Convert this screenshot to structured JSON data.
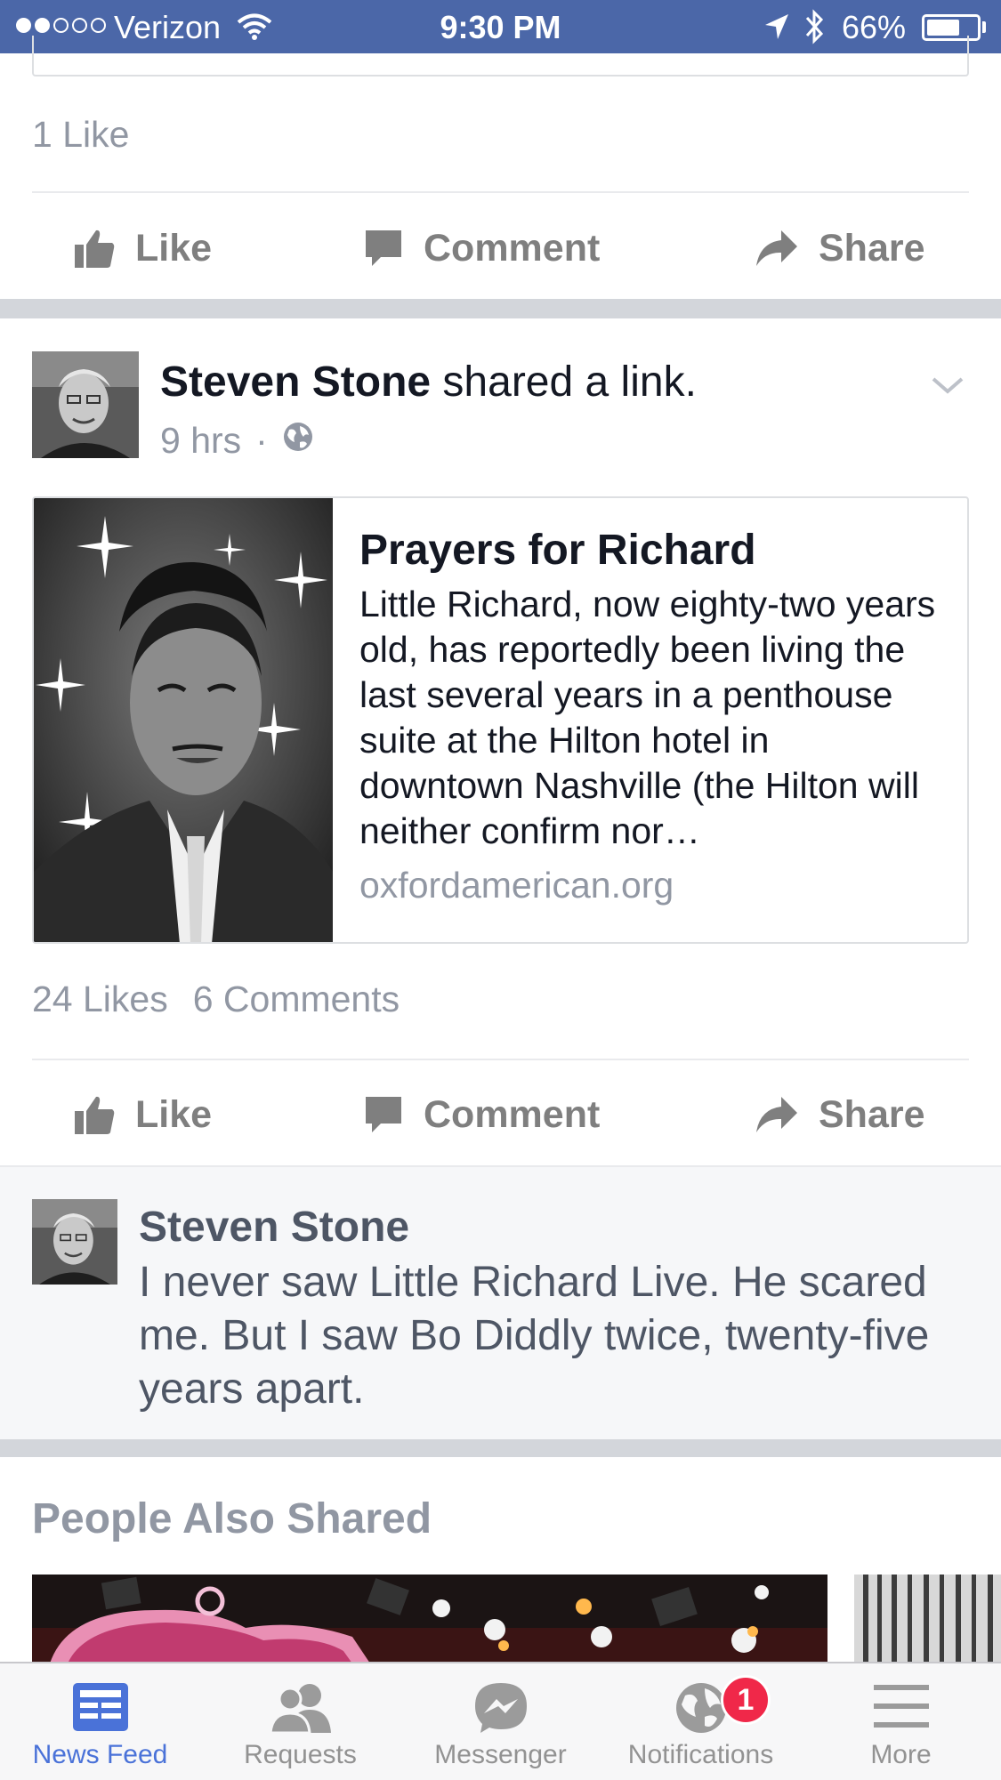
{
  "status_bar": {
    "carrier": "Verizon",
    "time": "9:30 PM",
    "battery_percent": "66%",
    "battery_level": 0.66,
    "signal_bars_filled": 2,
    "signal_bars_total": 5
  },
  "previous_post": {
    "likes_text": "1 Like"
  },
  "actions": {
    "like": "Like",
    "comment": "Comment",
    "share": "Share"
  },
  "post": {
    "author": "Steven Stone",
    "activity": "shared a link.",
    "time": "9 hrs",
    "separator": "·",
    "privacy_icon": "globe-icon",
    "link": {
      "title": "Prayers for Richard",
      "description": "Little Richard, now eighty-two years old, has reportedly been living the last several years in a penthouse suite at the Hilton hotel in downtown Nashville (the Hilton will neither confirm nor…",
      "domain": "oxfordamerican.org"
    },
    "likes_text": "24 Likes",
    "comments_text": "6 Comments"
  },
  "comment": {
    "author": "Steven Stone",
    "text": "I never saw Little Richard Live. He scared me. But I saw Bo Diddly twice, twenty-five years apart."
  },
  "people_also_shared": {
    "title": "People Also Shared"
  },
  "tab_bar": {
    "tabs": [
      {
        "label": "News Feed",
        "icon": "news-feed-icon",
        "active": true
      },
      {
        "label": "Requests",
        "icon": "requests-icon",
        "active": false
      },
      {
        "label": "Messenger",
        "icon": "messenger-icon",
        "active": false
      },
      {
        "label": "Notifications",
        "icon": "globe-icon",
        "active": false
      },
      {
        "label": "More",
        "icon": "menu-icon",
        "active": false
      }
    ],
    "notifications_badge": "1"
  },
  "colors": {
    "status_bar_bg": "#4b67a8",
    "active_tab": "#4a72d8",
    "badge": "#f02849",
    "action_text": "#7f7f7f"
  }
}
